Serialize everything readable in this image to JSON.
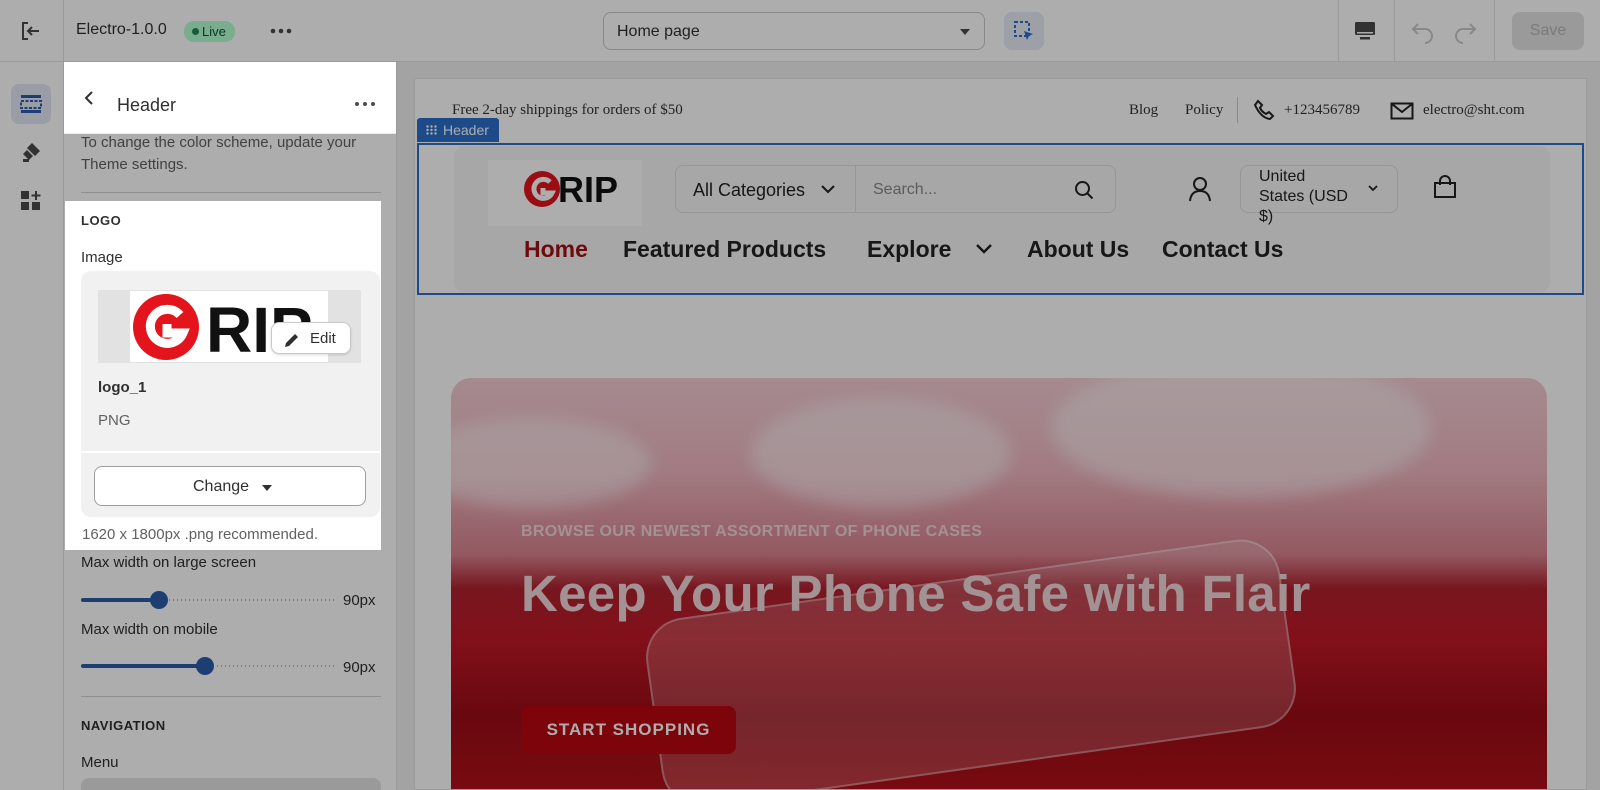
{
  "topbar": {
    "theme_name": "Electro-1.0.0",
    "live_badge": "Live",
    "page_selector": "Home page",
    "save_label": "Save"
  },
  "panel": {
    "title": "Header",
    "help_text": "To change the color scheme, update your Theme settings.",
    "logo_heading": "LOGO",
    "image_label": "Image",
    "edit_label": "Edit",
    "file_name": "logo_1",
    "file_type": "PNG",
    "change_label": "Change",
    "recommendation": "1620 x 1800px .png recommended.",
    "max_width_large_label": "Max width on large screen",
    "max_width_large_value": "90px",
    "max_width_large_fraction": 0.31,
    "max_width_mobile_label": "Max width on mobile",
    "max_width_mobile_value": "90px",
    "max_width_mobile_fraction": 0.49,
    "navigation_heading": "NAVIGATION",
    "menu_label": "Menu"
  },
  "preview": {
    "announcement": "Free 2-day shippings for orders of $50",
    "links": [
      "Blog",
      "Policy"
    ],
    "phone": "+123456789",
    "email": "electro@sht.com",
    "section_tag": "Header",
    "logo_text": "RIP",
    "category_select": "All Categories",
    "search_placeholder": "Search...",
    "currency": "United States (USD $)",
    "nav": [
      "Home",
      "Featured Products",
      "Explore",
      "About Us",
      "Contact Us"
    ],
    "hero_eyebrow": "BROWSE OUR NEWEST ASSORTMENT OF PHONE CASES",
    "hero_title": "Keep Your Phone Safe with Flair",
    "hero_cta": "START SHOPPING"
  },
  "colors": {
    "accent": "#2c6ecb",
    "brand_red": "#a30f12",
    "live_green": "#b4fed2"
  },
  "icons": [
    "exit-icon",
    "more-icon",
    "inspect-icon",
    "desktop-icon",
    "undo-icon",
    "redo-icon",
    "sections-icon",
    "brush-icon",
    "apps-icon",
    "back-icon",
    "pencil-icon",
    "phone-icon",
    "mail-icon",
    "search-icon",
    "account-icon",
    "cart-icon",
    "chevron-down-icon"
  ]
}
